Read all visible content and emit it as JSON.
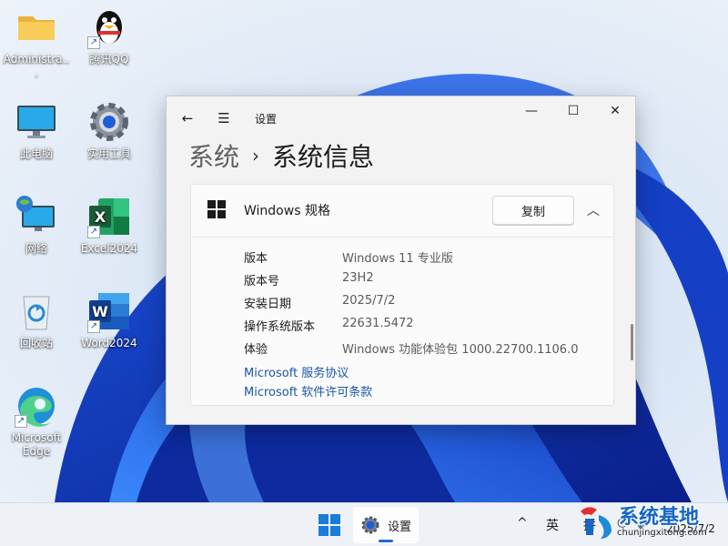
{
  "desktop": {
    "icons": [
      {
        "label": "Administra...",
        "icon": "folder-icon"
      },
      {
        "label": "腾讯QQ",
        "icon": "qq-penguin-icon"
      },
      {
        "label": "此电脑",
        "icon": "monitor-icon"
      },
      {
        "label": "实用工具",
        "icon": "gear-icon"
      },
      {
        "label": "网络",
        "icon": "network-globe-icon"
      },
      {
        "label": "Excel2024",
        "icon": "excel-icon"
      },
      {
        "label": "回收站",
        "icon": "recycle-bin-icon"
      },
      {
        "label": "Word2024",
        "icon": "word-icon"
      },
      {
        "label": "Microsoft Edge",
        "icon": "edge-icon"
      }
    ]
  },
  "window": {
    "title": "设置",
    "controls": {
      "back": "←",
      "menu": "☰",
      "minimize": "—",
      "maximize": "☐",
      "close": "✕"
    },
    "breadcrumb": {
      "parent": "系统",
      "separator": "›",
      "current": "系统信息"
    },
    "card": {
      "title": "Windows 规格",
      "copy_label": "复制",
      "collapse_glyph": "︿",
      "specs": [
        {
          "key": "版本",
          "value": "Windows 11 专业版"
        },
        {
          "key": "版本号",
          "value": "23H2"
        },
        {
          "key": "安装日期",
          "value": "2025/7/2"
        },
        {
          "key": "操作系统版本",
          "value": "22631.5472"
        },
        {
          "key": "体验",
          "value": "Windows 功能体验包 1000.22700.1106.0"
        }
      ],
      "links": [
        {
          "label": "Microsoft 服务协议"
        },
        {
          "label": "Microsoft 软件许可条款"
        }
      ]
    }
  },
  "taskbar": {
    "app_label": "设置",
    "tray_chevron": "^",
    "ime_label": "英",
    "ime_mode": "拼",
    "clock_date": "2025/7/2"
  },
  "watermark": {
    "title": "系统基地",
    "url": "chunjingxitong.com"
  },
  "colors": {
    "accent": "#1a6dd1",
    "link": "#1a56a8",
    "window_bg": "#f3f3f3"
  }
}
